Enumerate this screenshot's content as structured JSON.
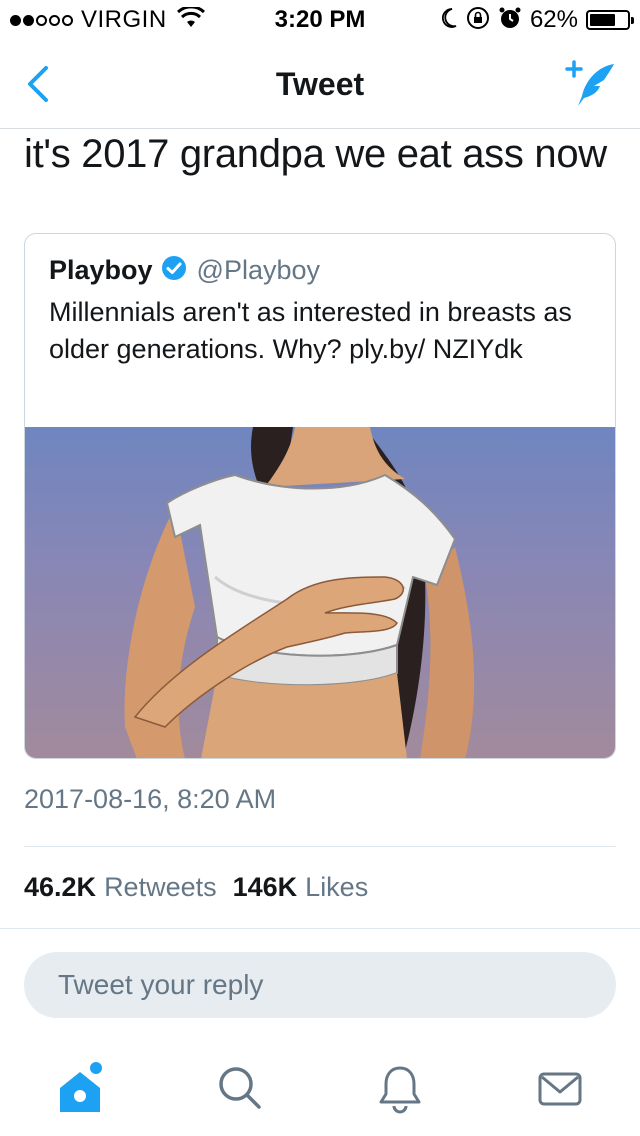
{
  "status_bar": {
    "carrier": "VIRGIN",
    "signal_bars_filled": 2,
    "signal_bars_total": 5,
    "time": "3:20 PM",
    "battery_percent": "62%"
  },
  "nav": {
    "title": "Tweet",
    "back_icon": "chevron-left-icon",
    "compose_icon": "compose-tweet-icon"
  },
  "tweet": {
    "text": "it's 2017 grandpa we eat ass now",
    "timestamp": "2017-08-16, 8:20 AM",
    "retweets_count": "46.2K",
    "retweets_label": "Retweets",
    "likes_count": "146K",
    "likes_label": "Likes"
  },
  "quoted_tweet": {
    "name": "Playboy",
    "handle": "@Playboy",
    "verified": true,
    "text": "Millennials aren't as interested in breasts as older generations. Why? ply.by/ NZIYdk",
    "media": "illustration-image"
  },
  "reply": {
    "placeholder": "Tweet your reply"
  },
  "tabbar": {
    "items": [
      "home-icon",
      "search-icon",
      "notifications-icon",
      "messages-icon"
    ],
    "active": "home-icon"
  },
  "colors": {
    "accent": "#1da1f2",
    "text": "#14171a",
    "secondary": "#657786",
    "border": "#e1e8ed"
  }
}
